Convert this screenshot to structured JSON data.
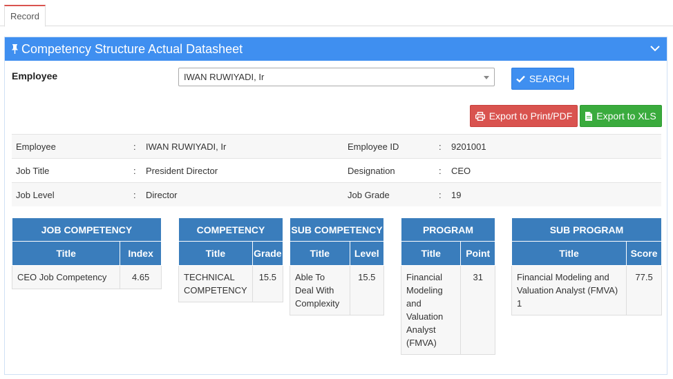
{
  "tabs": [
    {
      "label": "Record"
    }
  ],
  "panel": {
    "title": "Competency Structure Actual Datasheet"
  },
  "employee_select": {
    "label": "Employee",
    "value": "IWAN RUWIYADI, Ir"
  },
  "buttons": {
    "search": "SEARCH",
    "export_pdf": "Export to Print/PDF",
    "export_xls": "Export to XLS"
  },
  "info": {
    "employee_label": "Employee",
    "employee_value": "IWAN RUWIYADI, Ir",
    "employee_id_label": "Employee ID",
    "employee_id_value": "9201001",
    "job_title_label": "Job Title",
    "job_title_value": "President Director",
    "designation_label": "Designation",
    "designation_value": "CEO",
    "job_level_label": "Job Level",
    "job_level_value": "Director",
    "job_grade_label": "Job Grade",
    "job_grade_value": "19",
    "separator": ":"
  },
  "tables": {
    "job_competency": {
      "header": "JOB COMPETENCY",
      "col1": "Title",
      "col2": "Index",
      "rows": [
        {
          "title": "CEO Job Competency",
          "value": "4.65"
        }
      ]
    },
    "competency": {
      "header": "COMPETENCY",
      "col1": "Title",
      "col2": "Grade",
      "rows": [
        {
          "title": "TECHNICAL COMPETENCY",
          "value": "15.5"
        }
      ]
    },
    "sub_competency": {
      "header": "SUB COMPETENCY",
      "col1": "Title",
      "col2": "Level",
      "rows": [
        {
          "title": "Able To Deal With Complexity",
          "value": "15.5"
        }
      ]
    },
    "program": {
      "header": "PROGRAM",
      "col1": "Title",
      "col2": "Point",
      "rows": [
        {
          "title": "Financial Modeling and Valuation Analyst (FMVA)",
          "value": "31"
        }
      ]
    },
    "sub_program": {
      "header": "SUB PROGRAM",
      "col1": "Title",
      "col2": "Score",
      "rows": [
        {
          "title": "Financial Modeling and Valuation Analyst (FMVA) 1",
          "value": "77.5"
        }
      ]
    }
  },
  "colors": {
    "header_blue": "#3f8ff0",
    "table_blue": "#3a7dbc",
    "danger": "#d9534f",
    "success": "#3aab3d"
  }
}
